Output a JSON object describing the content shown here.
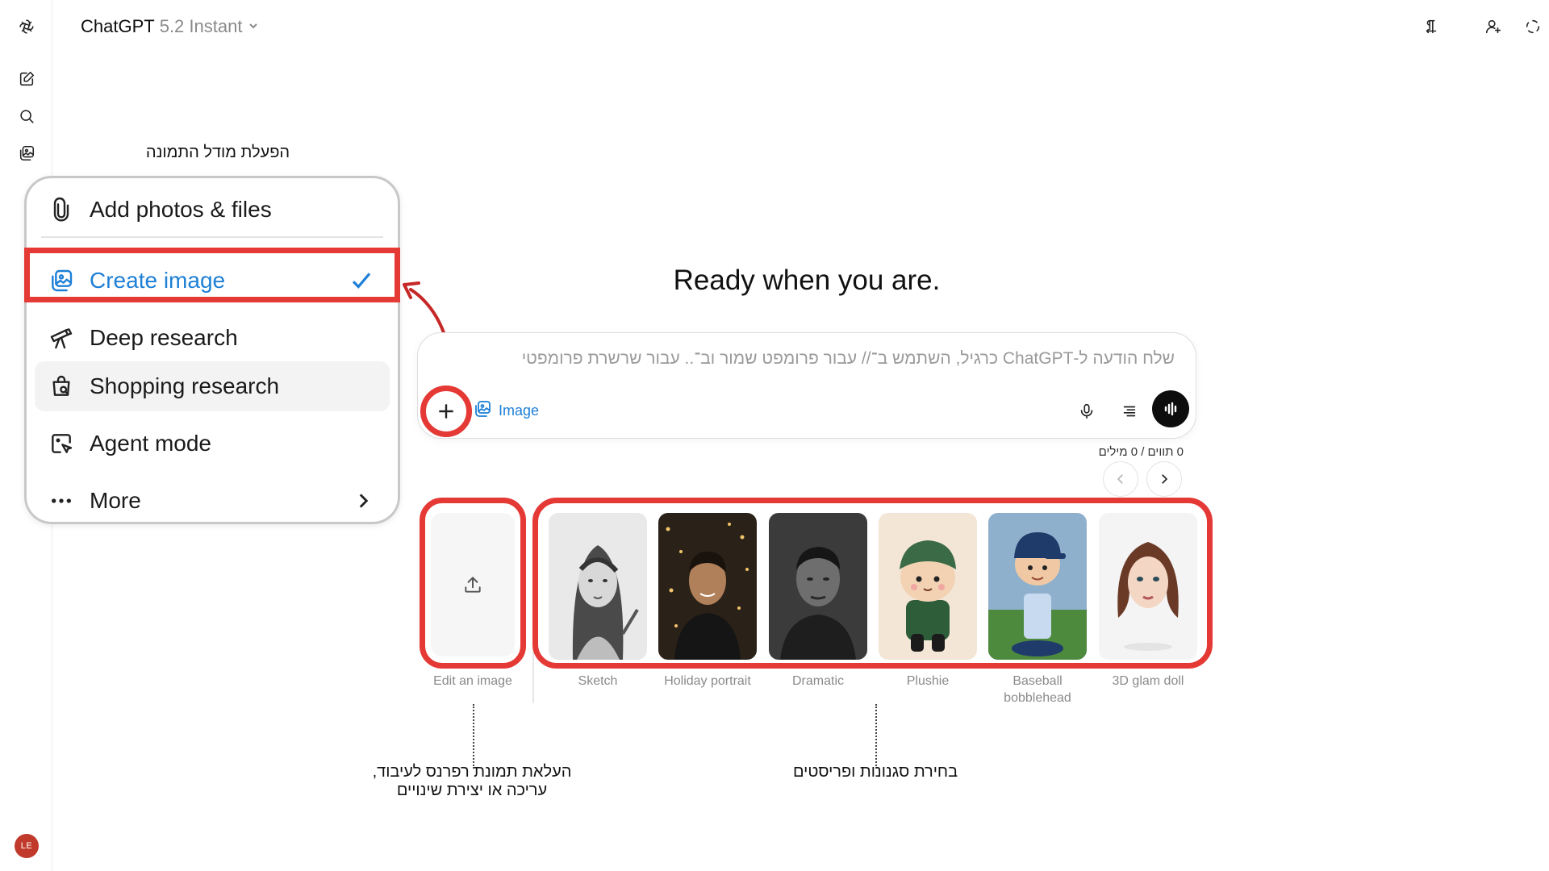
{
  "colors": {
    "accent": "#1d7fd6",
    "highlight": "#e53935",
    "avatar": "#c0392b"
  },
  "header": {
    "model_name": "ChatGPT",
    "model_variant": "5.2 Instant",
    "icons": [
      "rtl-direction-icon",
      "add-person-icon",
      "temporary-chat-icon"
    ]
  },
  "sidebar": {
    "icons": [
      "openai-logo-icon",
      "new-chat-icon",
      "search-icon",
      "images-icon"
    ],
    "avatar_initials": "LE"
  },
  "menu": {
    "caption": "הפעלת מודל התמונה",
    "items": [
      {
        "label": "Add photos & files",
        "icon": "paperclip-icon"
      },
      {
        "label": "Create image",
        "icon": "image-icon",
        "selected": true
      },
      {
        "label": "Deep research",
        "icon": "telescope-icon"
      },
      {
        "label": "Shopping research",
        "icon": "shopping-bag-icon"
      },
      {
        "label": "Agent mode",
        "icon": "agent-cursor-icon"
      },
      {
        "label": "More",
        "icon": "more-dots-icon"
      }
    ]
  },
  "main": {
    "hero": "Ready when you are.",
    "composer": {
      "placeholder": "שלח הודעה ל-ChatGPT כרגיל, השתמש ב־// עבור פרומפט שמור וב־.. עבור שרשרת פרומפטים",
      "image_chip": "Image"
    },
    "counter": "0 תווים / 0 מילים",
    "edit_card_label": "Edit an image",
    "presets": [
      {
        "label": "Sketch"
      },
      {
        "label": "Holiday portrait"
      },
      {
        "label": "Dramatic"
      },
      {
        "label": "Plushie"
      },
      {
        "label": "Baseball bobblehead"
      },
      {
        "label": "3D glam doll"
      }
    ]
  },
  "annotations": {
    "upload_note": "העלאת תמונת רפרנס לעיבוד, עריכה או יצירת שינויים",
    "styles_note": "בחירת סגנונות ופריסטים"
  }
}
